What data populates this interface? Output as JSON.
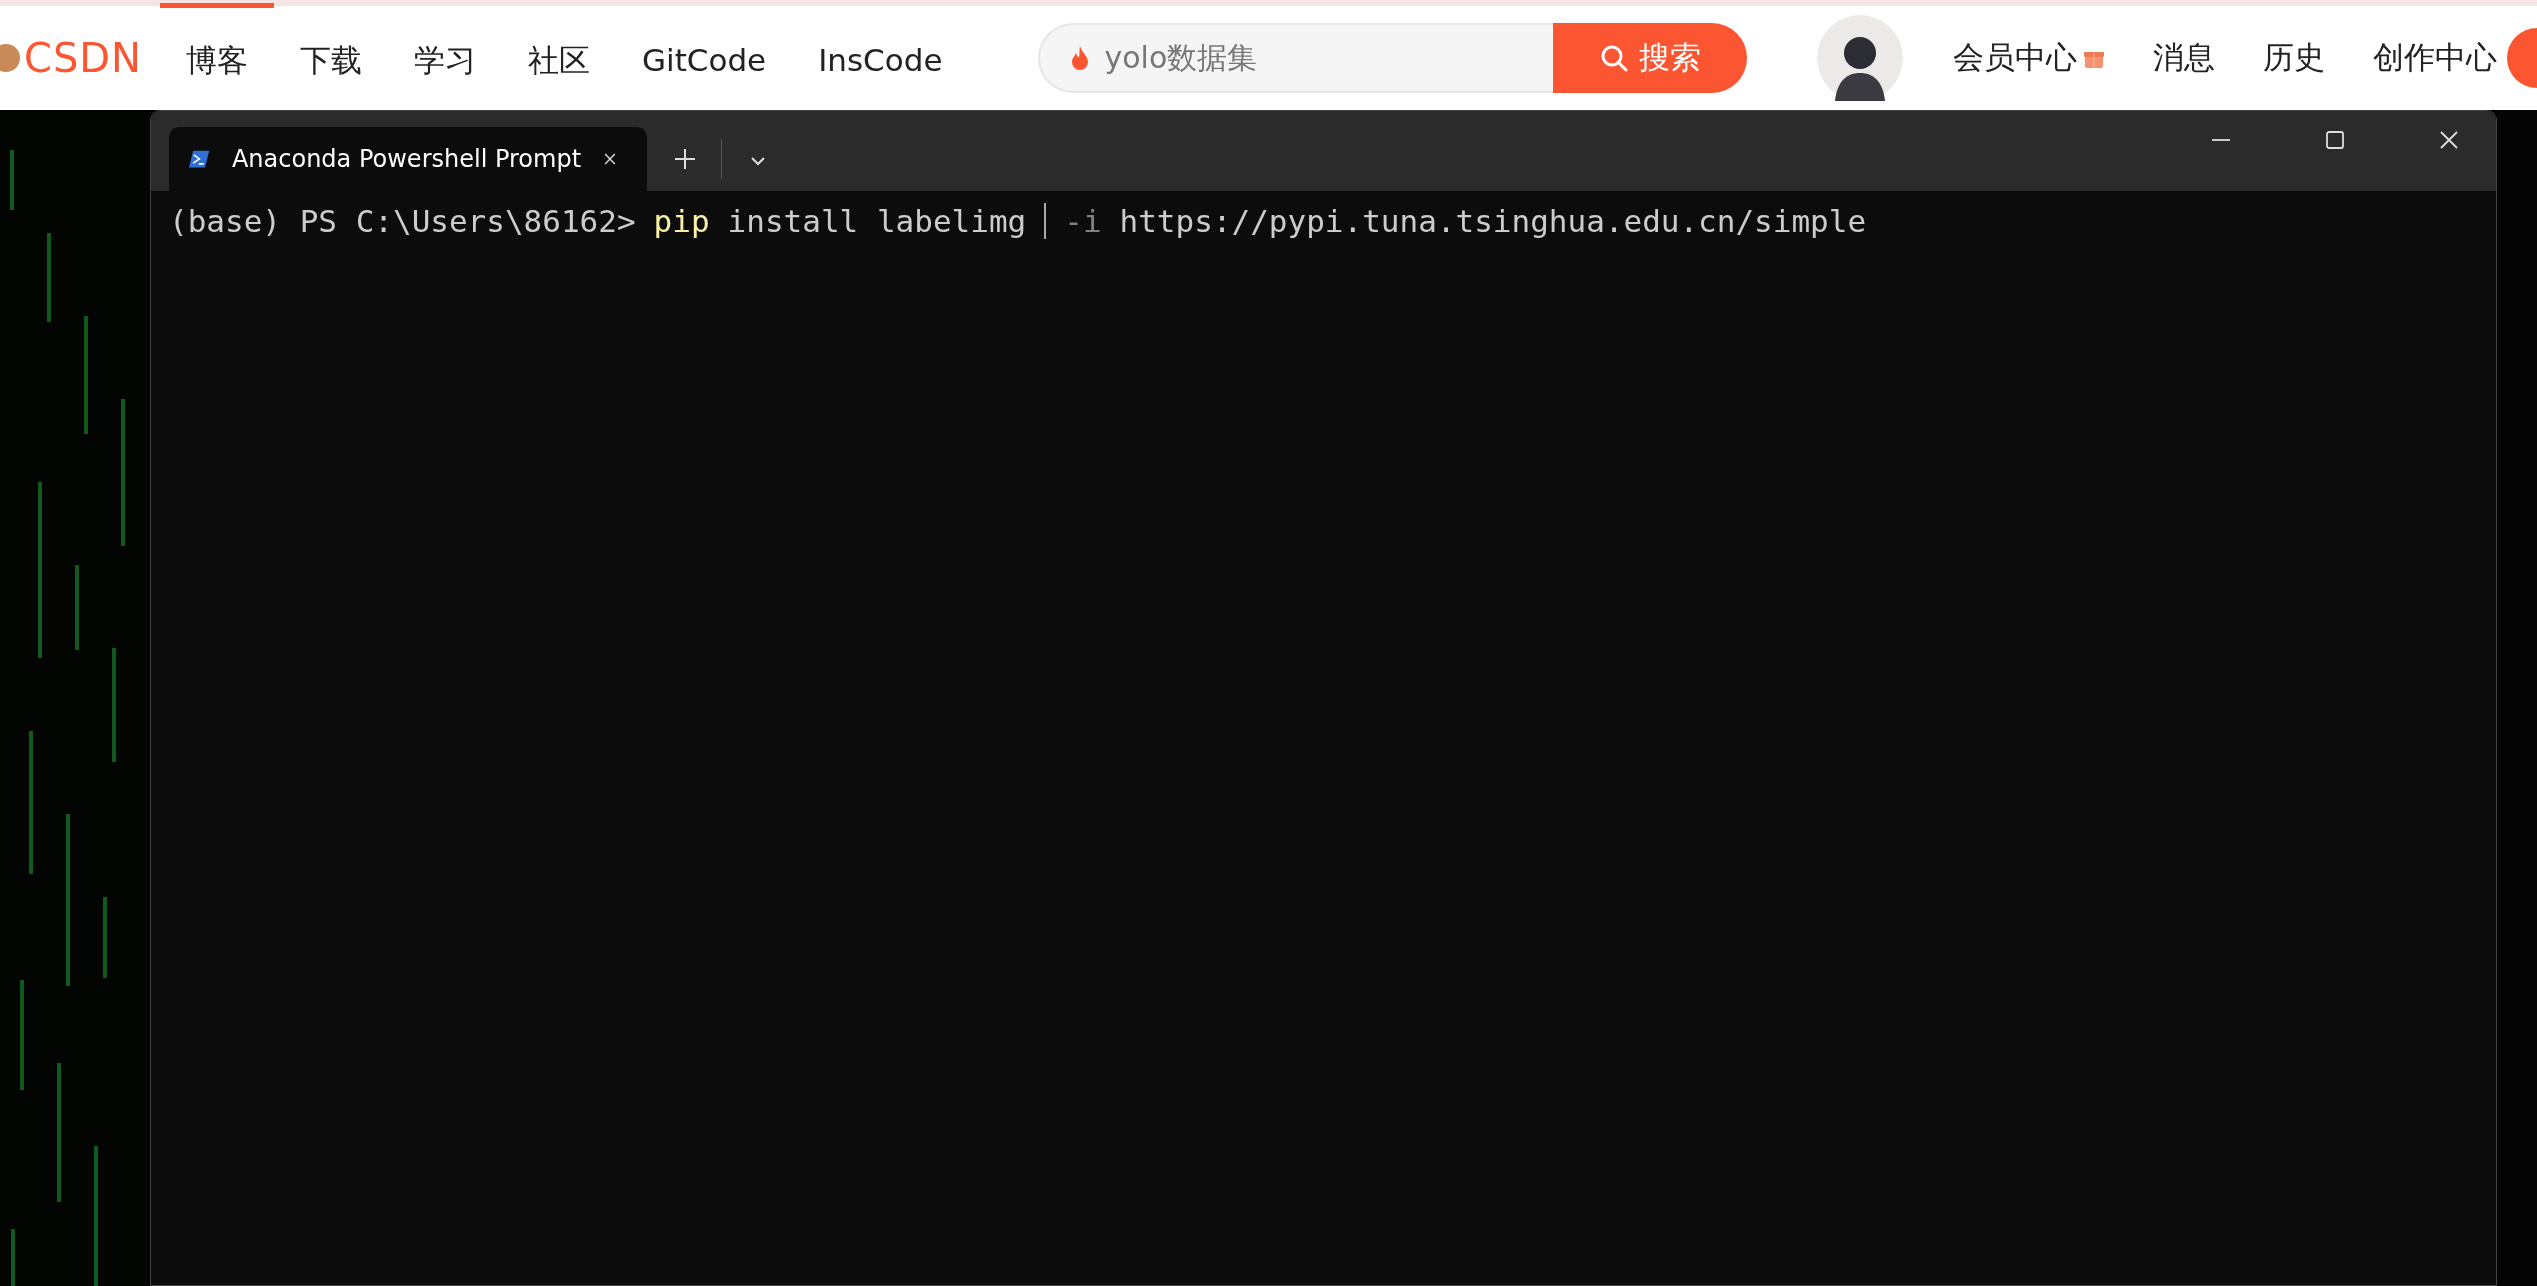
{
  "site_nav": {
    "logo": "CSDN",
    "items": [
      {
        "label": "博客",
        "selected": true
      },
      {
        "label": "下载",
        "selected": false
      },
      {
        "label": "学习",
        "selected": false
      },
      {
        "label": "社区",
        "selected": false
      },
      {
        "label": "GitCode",
        "selected": false
      },
      {
        "label": "InsCode",
        "selected": false
      }
    ],
    "search": {
      "value": "yolo数据集",
      "button": "搜索"
    },
    "user_items": [
      {
        "label": "会员中心",
        "gift": true
      },
      {
        "label": "消息",
        "gift": false
      },
      {
        "label": "历史",
        "gift": false
      },
      {
        "label": "创作中心",
        "gift": false
      }
    ]
  },
  "terminal": {
    "tabs": [
      {
        "title": "Anaconda Powershell Prompt",
        "selected": true
      }
    ],
    "lines": [
      {
        "segments": [
          {
            "kind": "prompt",
            "text": "(base) PS C:\\Users\\86162>"
          },
          {
            "kind": "command",
            "text": "pip"
          },
          {
            "kind": "argument",
            "text": "install labelimg"
          },
          {
            "kind": "cursor"
          },
          {
            "kind": "flag",
            "text": "-i"
          },
          {
            "kind": "argument",
            "text": "https://pypi.tuna.tsinghua.edu.cn/simple"
          }
        ]
      }
    ]
  }
}
